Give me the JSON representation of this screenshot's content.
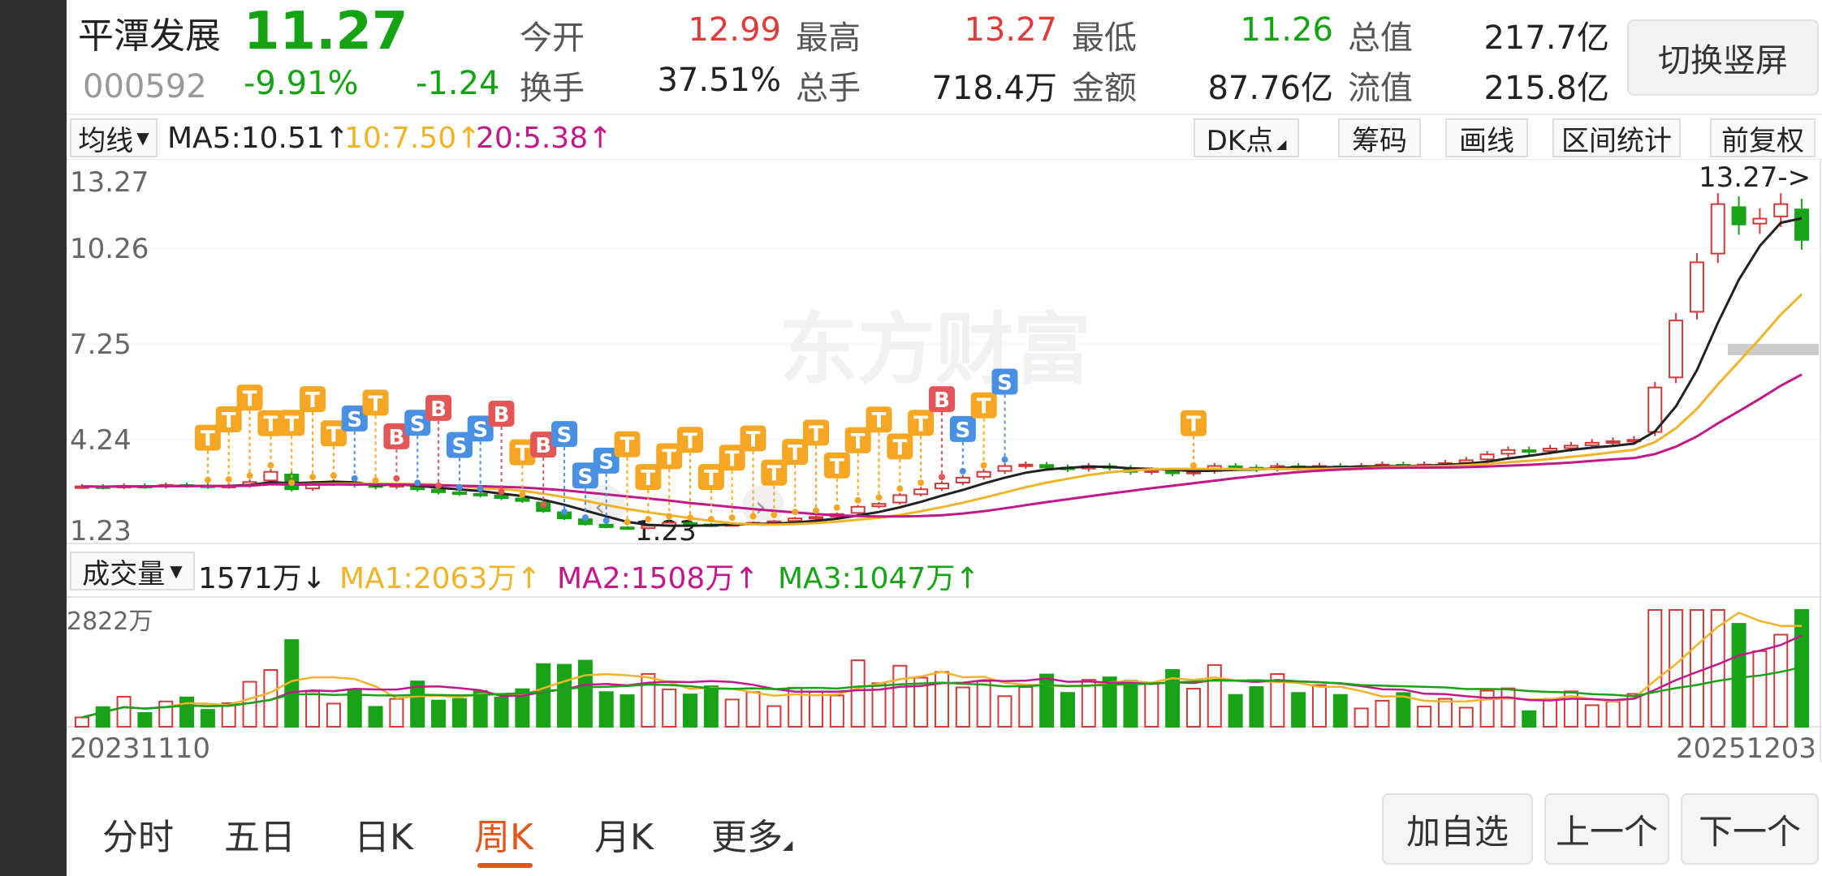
{
  "stock": {
    "name": "平潭发展",
    "price": "11.27",
    "code": "000592",
    "change_pct": "-9.91%",
    "change": "-1.24"
  },
  "quote": [
    {
      "label": "今开",
      "value": "12.99",
      "color": "#e03a3a"
    },
    {
      "label": "最高",
      "value": "13.27",
      "color": "#e03a3a"
    },
    {
      "label": "最低",
      "value": "11.26",
      "color": "#13a313"
    },
    {
      "label": "总值",
      "value": "217.7亿",
      "color": "#222222"
    },
    {
      "label": "换手",
      "value": "37.51%",
      "color": "#222222"
    },
    {
      "label": "总手",
      "value": "718.4万",
      "color": "#222222"
    },
    {
      "label": "金额",
      "value": "87.76亿",
      "color": "#222222"
    },
    {
      "label": "流值",
      "value": "215.8亿",
      "color": "#222222"
    }
  ],
  "switch_label": "切换竖屏",
  "toolbar": {
    "ma_select": "均线",
    "ma5": "MA5:10.51↑",
    "ma10": "10:7.50↑",
    "ma20": "20:5.38↑",
    "dk": "DK点",
    "chips": "筹码",
    "draw": "画线",
    "range": "区间统计",
    "adjust": "前复权"
  },
  "volume_bar": {
    "select": "成交量",
    "value": "1571万↓",
    "ma1": "MA1:2063万↑",
    "ma2": "MA2:1508万↑",
    "ma3": "MA3:1047万↑"
  },
  "colors": {
    "up": "#d23a3a",
    "down": "#19a319",
    "ma5": "#222222",
    "ma10": "#f0b429",
    "ma20": "#c2188a",
    "accent": "#e2561b"
  },
  "chart_data": {
    "type": "candlestick",
    "y_ticks": [
      "13.27",
      "10.26",
      "7.25",
      "4.24",
      "1.23"
    ],
    "high_marker": "13.27->",
    "low_marker": "1.23",
    "volume_max_label": "2822万",
    "date_start": "20231110",
    "date_end": "20251203",
    "signals": [
      "T",
      "T",
      "T",
      "T",
      "T",
      "T",
      "T",
      "S",
      "T",
      "B",
      "S",
      "B",
      "S",
      "S",
      "B",
      "T",
      "B",
      "S",
      "S",
      "S",
      "T",
      "T",
      "T",
      "T",
      "T",
      "T",
      "T",
      "T",
      "T",
      "T",
      "T",
      "T",
      "T",
      "T",
      "T",
      "B",
      "S",
      "T",
      "S",
      "T"
    ],
    "weekly_closes": [
      2.8,
      2.78,
      2.82,
      2.8,
      2.85,
      2.83,
      2.8,
      2.82,
      2.95,
      3.3,
      2.7,
      2.9,
      2.95,
      2.85,
      2.78,
      2.85,
      2.7,
      2.6,
      2.55,
      2.5,
      2.4,
      2.3,
      1.95,
      1.7,
      1.5,
      1.4,
      1.35,
      1.45,
      1.55,
      1.5,
      1.45,
      1.5,
      1.55,
      1.6,
      1.7,
      1.75,
      1.85,
      2.1,
      2.2,
      2.5,
      2.7,
      2.9,
      3.1,
      3.3,
      3.5,
      3.55,
      3.45,
      3.4,
      3.5,
      3.45,
      3.3,
      3.35,
      3.25,
      3.3,
      3.5,
      3.45,
      3.4,
      3.5,
      3.45,
      3.5,
      3.45,
      3.5,
      3.55,
      3.5,
      3.55,
      3.6,
      3.7,
      3.9,
      4.05,
      4.0,
      4.1,
      4.2,
      4.3,
      4.35,
      4.4,
      6.2,
      8.5,
      10.5,
      12.5,
      11.8,
      12.0,
      12.5,
      11.27
    ]
  },
  "nav": {
    "tabs": [
      "分时",
      "五日",
      "日K",
      "周K",
      "月K",
      "更多"
    ],
    "active": "周K",
    "buttons": [
      "加自选",
      "上一个",
      "下一个"
    ]
  }
}
